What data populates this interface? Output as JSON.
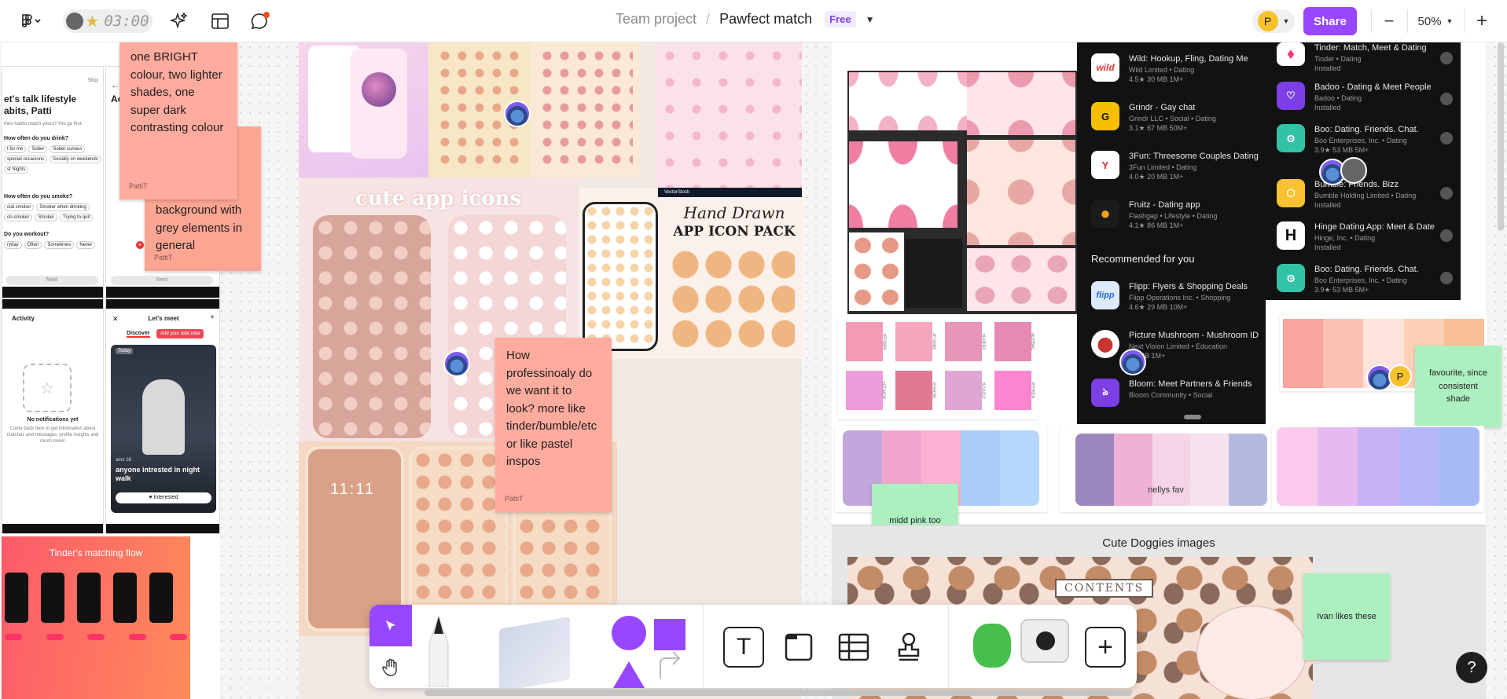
{
  "toolbar": {
    "timer": "03:00",
    "breadcrumb_team": "Team project",
    "breadcrumb_sep": "/",
    "file_name": "Pawfect match",
    "plan_badge": "Free",
    "avatar_initial": "P",
    "share_label": "Share",
    "zoom_out": "−",
    "zoom_level": "50%",
    "zoom_in": "+"
  },
  "stickies": {
    "bright": {
      "text": "one BRIGHT colour, two lighter shades, one super dark contrasting colour",
      "author": "PattiT"
    },
    "grey": {
      "text": "background with grey elements in general",
      "author": "PattiT"
    },
    "professional": {
      "text": "How professinoaly do we want it to look? more like tinder/bumble/etc or like pastel inspos",
      "author": "PattiT"
    },
    "favourite": {
      "text": "favourite, since consistent shade"
    },
    "midd_pink": {
      "text": "midd pink too bright"
    },
    "ivan": {
      "text": "Ivan likes these"
    }
  },
  "labels": {
    "nellys_fav": "nellys fav",
    "cute_doggies": "Cute Doggies images",
    "tinder_flow": "Tinder's matching flow",
    "cute_app_icons": "cute app icons",
    "hand_drawn_1": "Hand Drawn",
    "hand_drawn_2": "APP ICON PACK",
    "contents": "CONTENTS",
    "vectorstock": "VectorStock"
  },
  "phone_left": {
    "title": "et's talk lifestyle abits, Patti",
    "sub": "their habits match yours? You go first.",
    "skip": "Skip",
    "q1": "How often do you drink?",
    "q1_opts": [
      "t for me",
      "Sober",
      "Sober curious",
      "special occasions",
      "Socially on weekends",
      "st Nights"
    ],
    "q2": "How often do you smoke?",
    "q2_opts": [
      "cial smoker",
      "Smoker when drinking",
      "on-smoker",
      "Smoker",
      "Trying to quit"
    ],
    "q3": "Do you workout?",
    "q3_opts": [
      "ryday",
      "Often",
      "Sometimes",
      "Never"
    ],
    "next": "Next"
  },
  "phone_mid": {
    "header": "Ac",
    "next": "Next"
  },
  "phone_activity": {
    "title": "Activity",
    "empty_title": "No notifications yet",
    "empty_body": "Come back here to get information about matches and messages, profile insights and much more!"
  },
  "phone_meet": {
    "title": "Let's meet",
    "tab_discover": "Discover",
    "add_idea": "Add your date idea",
    "badge": "Today",
    "card_name": "amir 28",
    "card_caption": "anyone intrested in night walk",
    "interested": "♥ Interested"
  },
  "play_left": {
    "apps": [
      {
        "name": "Wild: Hookup, Fling, Dating Me",
        "dev": "Wild Limited • Dating",
        "meta": "4.5★  30 MB  1M+",
        "icon": "wild",
        "color": "#e33b3b"
      },
      {
        "name": "Grindr - Gay chat",
        "dev": "Grindr LLC • Social • Dating",
        "meta": "3.1★  67 MB  50M+",
        "icon": "G",
        "color": "#f6c000"
      },
      {
        "name": "3Fun: Threesome Couples Dating",
        "dev": "3Fun Limited • Dating",
        "meta": "4.0★  20 MB  1M+",
        "icon": "3F",
        "color": "#e22a3a"
      },
      {
        "name": "Fruitz - Dating app",
        "dev": "Flashgap • Lifestyle • Dating",
        "meta": "4.1★  86 MB  1M+",
        "icon": "F",
        "color": "#f4a21a"
      }
    ],
    "section": "Recommended for you",
    "recs": [
      {
        "name": "Flipp: Flyers & Shopping Deals",
        "dev": "Flipp Operations Inc. • Shopping",
        "meta": "4.6★  29 MB  10M+",
        "icon": "flipp",
        "color": "#2a6bd8"
      },
      {
        "name": "Picture Mushroom - Mushroom ID",
        "dev": "Next Vision Limited • Education",
        "meta": "26 MB  1M+",
        "icon": "PM",
        "color": "#c8352e"
      },
      {
        "name": "Bloom: Meet Partners & Friends",
        "dev": "Bloom Community • Social",
        "meta": "",
        "icon": "B",
        "color": "#7b3fe4"
      }
    ]
  },
  "play_right": {
    "apps": [
      {
        "name": "Tinder: Match, Meet & Dating",
        "dev": "Tinder • Dating",
        "meta": "Installed",
        "icon": "T",
        "color": "#fe3c72"
      },
      {
        "name": "Badoo - Dating & Meet People",
        "dev": "Badoo • Dating",
        "meta": "Installed",
        "icon": "B",
        "color": "#7b3fe4"
      },
      {
        "name": "Boo: Dating. Friends. Chat.",
        "dev": "Boo Enterprises, Inc. • Dating",
        "meta": "3.9★  53 MB  5M+",
        "icon": "b",
        "color": "#34c2a6"
      },
      {
        "name": "Bumble: Friends. Bizz",
        "dev": "Bumble Holding Limited • Dating",
        "meta": "Installed",
        "icon": "bb",
        "color": "#f9c22e"
      },
      {
        "name": "Hinge Dating App: Meet & Date",
        "dev": "Hinge, Inc. • Dating",
        "meta": "Installed",
        "icon": "H",
        "color": "#111111"
      },
      {
        "name": "Boo: Dating. Friends. Chat.",
        "dev": "Boo Enterprises, Inc. • Dating",
        "meta": "3.9★  53 MB  5M+",
        "icon": "b",
        "color": "#34c2a6"
      }
    ]
  },
  "palettes": {
    "pink_codes": [
      "#FF9AB5",
      "#F7A6BE",
      "#E48FB3",
      "#E37BAC",
      "#EE9ADB",
      "#E66E8E",
      "#E1A2D2",
      "#FF86D4"
    ],
    "pink_swatches": [
      "#f29bb3",
      "#f5a6bd",
      "#e795b8",
      "#e58ab5",
      "#ed9dda",
      "#e17992",
      "#e0a6d3",
      "#fb86cf"
    ],
    "palette_1": [
      "#c2a6dc",
      "#f2a6cd",
      "#fbb1d1",
      "#a9cdf6",
      "#b7d6fb"
    ],
    "palette_nelly": [
      "#9b86be",
      "#ecb1d3",
      "#f4d4e6",
      "#f6e2ec",
      "#b6b9df"
    ],
    "palette_fav": [
      "#f9a49c",
      "#fbc1b3",
      "#fde3dc",
      "#fdd0b8",
      "#fbbf95"
    ],
    "palette_4": [
      "#fbc9ee",
      "#e7b9f2",
      "#c7b1f4",
      "#b6b7f6",
      "#a9bbf7"
    ]
  },
  "bottom_tools": {
    "select": "move-cursor",
    "hand": "hand",
    "text": "T",
    "frame": "frame",
    "table": "table",
    "stamp": "stamp",
    "add": "+"
  },
  "help_label": "?",
  "colors": {
    "accent": "#9747ff",
    "sticky_salmon": "#ffab9e",
    "sticky_green": "#adf0c0"
  }
}
